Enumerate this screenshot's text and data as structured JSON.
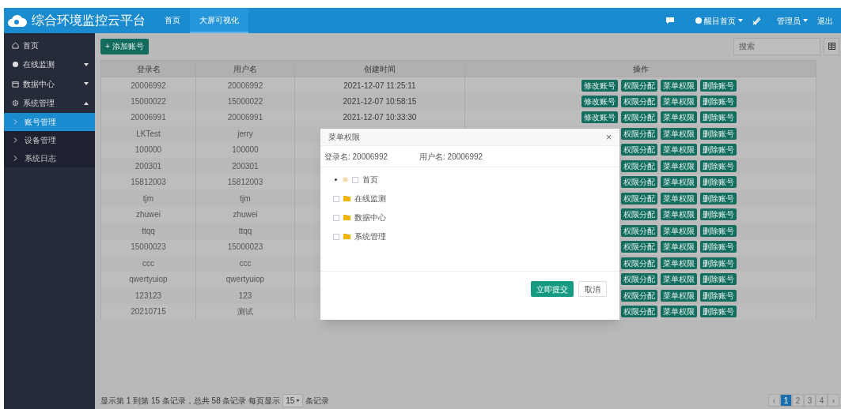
{
  "header": {
    "title": "综合环境监控云平台",
    "nav": [
      {
        "label": "首页",
        "selected": false
      },
      {
        "label": "大屏可视化",
        "selected": true
      }
    ],
    "theme": "醒目首页",
    "user": "管理员",
    "logout": "退出"
  },
  "sidebar": {
    "items": [
      {
        "label": "首页",
        "selected": false
      },
      {
        "label": "在线监测",
        "expanded": false,
        "selected": false
      },
      {
        "label": "数据中心",
        "expanded": false,
        "selected": false
      },
      {
        "label": "系统管理",
        "expanded": true,
        "selected": false,
        "children": [
          {
            "label": "账号管理",
            "selected": true
          },
          {
            "label": "设备管理",
            "selected": false
          },
          {
            "label": "系统日志",
            "selected": false
          }
        ]
      }
    ]
  },
  "toolbar": {
    "add_button": "+ 添加账号",
    "search": {
      "placeholder": "搜索"
    }
  },
  "table": {
    "columns": [
      "登录名",
      "用户名",
      "创建时间",
      "操作"
    ],
    "rows": [
      {
        "login": "20006992",
        "user": "20006992",
        "time": "2021-12-07 11:25:11",
        "actions": [
          "修改账号",
          "权限分配",
          "菜单权限",
          "删除账号"
        ]
      },
      {
        "login": "15000022",
        "user": "15000022",
        "time": "2021-12-07 10:58:15",
        "actions": [
          "修改账号",
          "权限分配",
          "菜单权限",
          "删除账号"
        ]
      },
      {
        "login": "20006991",
        "user": "20006991",
        "time": "2021-12-07 10:33:30",
        "actions": [
          "修改账号",
          "权限分配",
          "菜单权限",
          "删除账号"
        ]
      },
      {
        "login": "LKTest",
        "user": "jerry",
        "actions": [
          "权限分配",
          "菜单权限",
          "删除账号"
        ]
      },
      {
        "login": "100000",
        "user": "100000",
        "actions": [
          "权限分配",
          "菜单权限",
          "删除账号"
        ]
      },
      {
        "login": "200301",
        "user": "200301",
        "actions": [
          "权限分配",
          "菜单权限",
          "删除账号"
        ]
      },
      {
        "login": "15812003",
        "user": "15812003",
        "actions": [
          "权限分配",
          "菜单权限",
          "删除账号"
        ]
      },
      {
        "login": "tjm",
        "user": "tjm",
        "actions": [
          "权限分配",
          "菜单权限",
          "删除账号"
        ]
      },
      {
        "login": "zhuwei",
        "user": "zhuwei",
        "actions": [
          "权限分配",
          "菜单权限",
          "删除账号"
        ]
      },
      {
        "login": "ttqq",
        "user": "ttqq",
        "actions": [
          "权限分配",
          "菜单权限",
          "删除账号"
        ]
      },
      {
        "login": "15000023",
        "user": "15000023",
        "actions": [
          "权限分配",
          "菜单权限",
          "删除账号"
        ]
      },
      {
        "login": "ccc",
        "user": "ccc",
        "actions": [
          "权限分配",
          "菜单权限",
          "删除账号"
        ]
      },
      {
        "login": "qwertyuiop",
        "user": "qwertyuiop",
        "actions": [
          "权限分配",
          "菜单权限",
          "删除账号"
        ]
      },
      {
        "login": "123123",
        "user": "123",
        "actions": [
          "权限分配",
          "菜单权限",
          "删除账号"
        ]
      },
      {
        "login": "20210715",
        "user": "测试",
        "actions": [
          "权限分配",
          "菜单权限",
          "删除账号"
        ]
      }
    ]
  },
  "footer": {
    "info": "显示第 1 到第 15 条记录，总共 58 条记录 每页显示",
    "page_size": "15",
    "suffix": "条记录",
    "pages": [
      {
        "label": "‹",
        "selected": false
      },
      {
        "label": "1",
        "selected": true
      },
      {
        "label": "2",
        "selected": false
      },
      {
        "label": "3",
        "selected": false
      },
      {
        "label": "4",
        "selected": false
      },
      {
        "label": "›",
        "selected": false
      }
    ]
  },
  "dialog": {
    "title": "菜单权限",
    "close": "×",
    "login": "登录名: 20006992",
    "user": "用户名: 20006992",
    "tree": [
      {
        "label": "首页",
        "kind": "leaf",
        "checked": false
      },
      {
        "label": "在线监测",
        "kind": "folder",
        "checked": false
      },
      {
        "label": "数据中心",
        "kind": "folder",
        "checked": false
      },
      {
        "label": "系统管理",
        "kind": "folder",
        "checked": false
      }
    ],
    "submit": "立即提交",
    "cancel": "取消"
  }
}
